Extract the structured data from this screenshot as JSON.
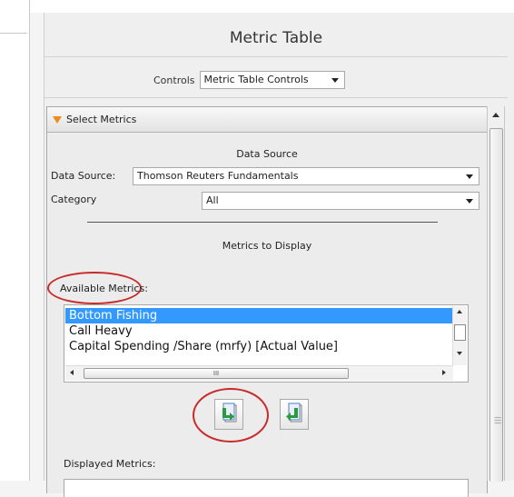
{
  "window": {
    "title": "Metric Table"
  },
  "controls": {
    "label": "Controls",
    "selected": "Metric Table Controls"
  },
  "section": {
    "title": "Select Metrics",
    "data_source_heading": "Data Source",
    "data_source_label": "Data Source:",
    "data_source_value": "Thomson Reuters Fundamentals",
    "category_label": "Category",
    "category_value": "All",
    "metrics_heading": "Metrics to Display",
    "available_label": "Available Metrics:",
    "available_items": [
      "Bottom Fishing",
      "Call Heavy",
      "Capital Spending /Share (mrfy) [Actual Value]"
    ],
    "selected_index": 0,
    "hscroll_grip": "III",
    "displayed_label": "Displayed Metrics:"
  },
  "annotations": {
    "highlight_color": "#c92a2a"
  },
  "colors": {
    "selection": "#3399ff",
    "section_icon": "#f08a1c",
    "add_arrow": "#2e9a3e",
    "sheet": "#4a7fc9"
  }
}
